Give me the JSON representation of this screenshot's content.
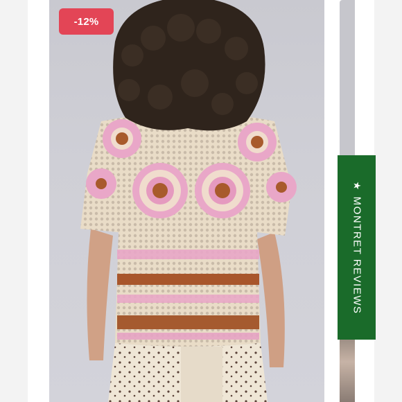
{
  "product_card": {
    "discount_badge": "-12%",
    "image": {
      "subject": "model-wearing-crochet-top",
      "colors": {
        "background": "#cbcbd2",
        "hair": "#2e231c",
        "skin": "#d4a58b",
        "cream": "#eee2cf",
        "pink": "#eaa3c6",
        "brown": "#a9572a"
      }
    }
  },
  "reviews_tab": {
    "icon": "star-icon",
    "label": "MONTRET REVIEWS",
    "color": "#1a6b2a"
  },
  "theme": {
    "badge_color": "#e34556"
  }
}
